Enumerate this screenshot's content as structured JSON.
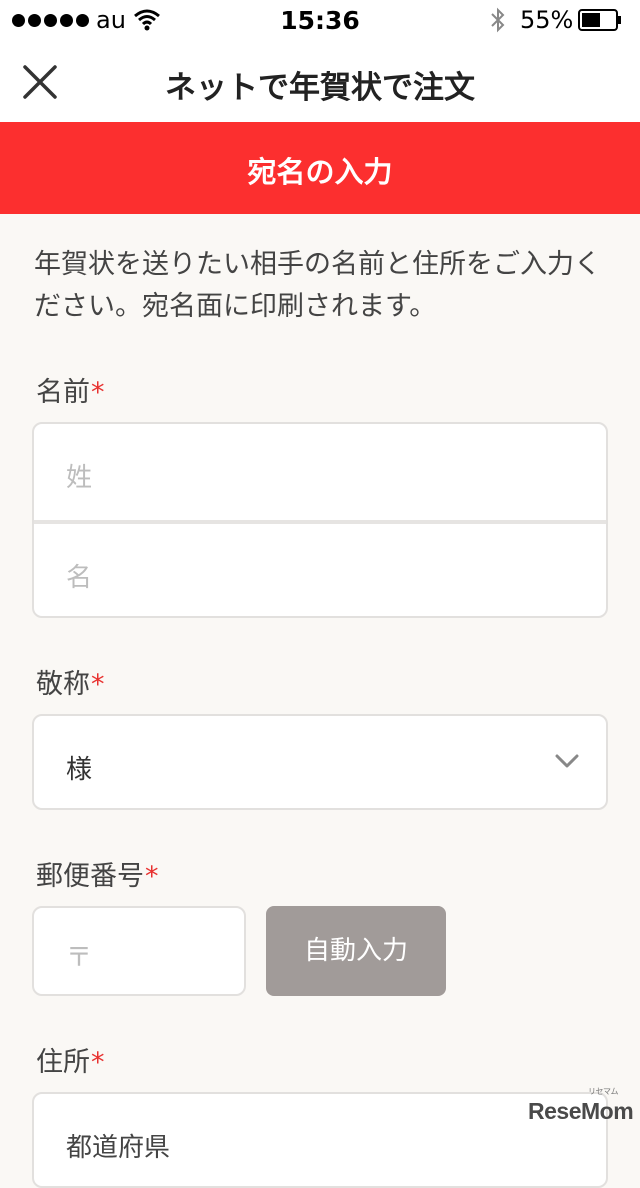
{
  "status_bar": {
    "carrier": "au",
    "time": "15:36",
    "battery": "55%",
    "battery_level": 0.55,
    "signal_bars": 5
  },
  "header": {
    "title": "ネットで年賀状で注文",
    "close_icon": "close-x-icon"
  },
  "section": {
    "title": "宛名の入力",
    "color": "#fc2f2f"
  },
  "intro_text": "年賀状を送りたい相手の名前と住所をご入力ください。宛名面に印刷されます。",
  "form": {
    "required_mark": "*",
    "required_color": "#e8312f",
    "name": {
      "label": "名前",
      "last_placeholder": "姓",
      "first_placeholder": "名"
    },
    "honorific": {
      "label": "敬称",
      "value": "様",
      "icon": "chevron-down-icon"
    },
    "postal": {
      "label": "郵便番号",
      "placeholder": "〒",
      "button_label": "自動入力"
    },
    "address": {
      "label": "住所",
      "placeholder": "都道府県"
    }
  },
  "watermark": {
    "text": "ReseMom",
    "sub": "リセマム"
  }
}
